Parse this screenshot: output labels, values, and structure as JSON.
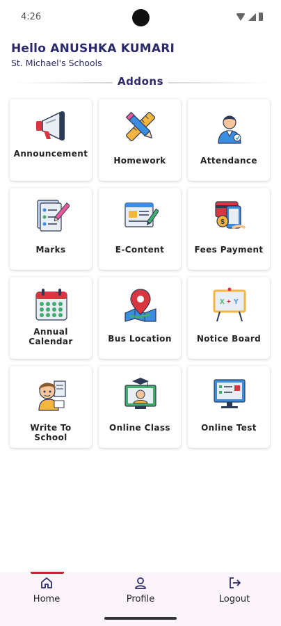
{
  "status_bar": {
    "time": "4:26"
  },
  "header": {
    "greeting": "Hello ANUSHKA KUMARI",
    "school": "St. Michael's Schools"
  },
  "section": {
    "title": "Addons"
  },
  "addons": [
    {
      "label": "Announcement",
      "icon": "megaphone-icon"
    },
    {
      "label": "Homework",
      "icon": "pencil-ruler-icon"
    },
    {
      "label": "Attendance",
      "icon": "teacher-icon"
    },
    {
      "label": "Marks",
      "icon": "marks-sheet-icon"
    },
    {
      "label": "E-Content",
      "icon": "e-content-icon"
    },
    {
      "label": "Fees Payment",
      "icon": "fees-payment-icon"
    },
    {
      "label": "Annual Calendar",
      "icon": "calendar-icon"
    },
    {
      "label": "Bus Location",
      "icon": "map-pin-icon"
    },
    {
      "label": "Notice Board",
      "icon": "notice-board-icon"
    },
    {
      "label": "Write To School",
      "icon": "student-writing-icon"
    },
    {
      "label": "Online Class",
      "icon": "online-class-icon"
    },
    {
      "label": "Online Test",
      "icon": "online-test-icon"
    }
  ],
  "bottom_nav": {
    "items": [
      {
        "label": "Home",
        "icon": "home-icon",
        "active": true
      },
      {
        "label": "Profile",
        "icon": "profile-icon",
        "active": false
      },
      {
        "label": "Logout",
        "icon": "logout-icon",
        "active": false
      }
    ]
  },
  "colors": {
    "title": "#2b2a6b",
    "active_indicator": "#c0282d",
    "nav_background": "#fbf4fb"
  }
}
